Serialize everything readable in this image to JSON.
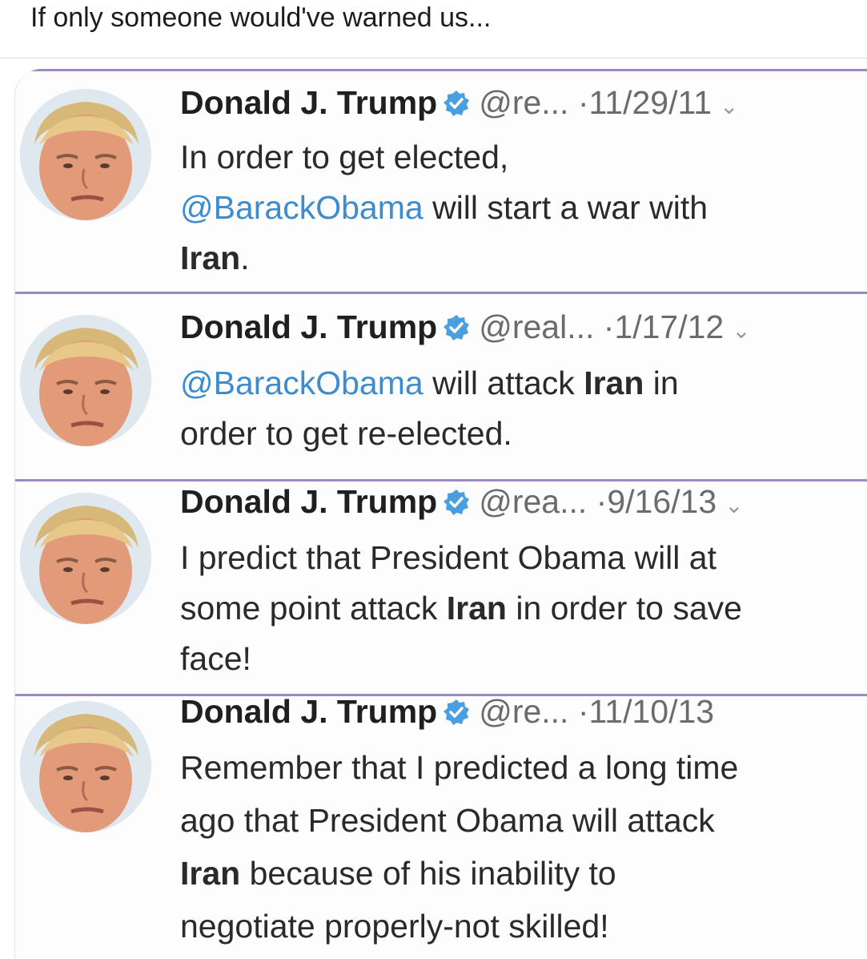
{
  "caption": "If only someone would've warned us...",
  "tweets": [
    {
      "name": "Donald J. Trump",
      "handle": "@re...",
      "separator": "·",
      "date": "11/29/11",
      "text_1": "In order to get elected,",
      "mention": "@BarackObama",
      "text_2": " will start a war with",
      "bold_1": "Iran",
      "text_3": "."
    },
    {
      "name": "Donald J. Trump",
      "handle": "@real...",
      "separator": "·",
      "date": "1/17/12",
      "mention": "@BarackObama",
      "text_1": " will attack ",
      "bold_1": "Iran",
      "text_2": " in",
      "text_3": "order to get re-elected."
    },
    {
      "name": "Donald J. Trump",
      "handle": "@rea...",
      "separator": "·",
      "date": "9/16/13",
      "text_1": "I predict that President Obama will at",
      "text_2": "some point attack ",
      "bold_1": "Iran",
      "text_3": " in order to save",
      "text_4": "face!"
    },
    {
      "name": "Donald J. Trump",
      "handle": "@re...",
      "separator": "·",
      "date": "11/10/13",
      "text_1": "Remember that I predicted a long time",
      "text_2": "ago that President Obama will attack",
      "bold_1": "Iran",
      "text_3": " because of his inability to",
      "text_4": "negotiate properly-not skilled!"
    }
  ],
  "colors": {
    "divider": "#9b89bf",
    "mention": "#3d8ccf",
    "verified_badge": "#4a9fe0"
  },
  "icons": {
    "verified": "verified-badge-icon",
    "caret": "chevron-down-icon"
  }
}
